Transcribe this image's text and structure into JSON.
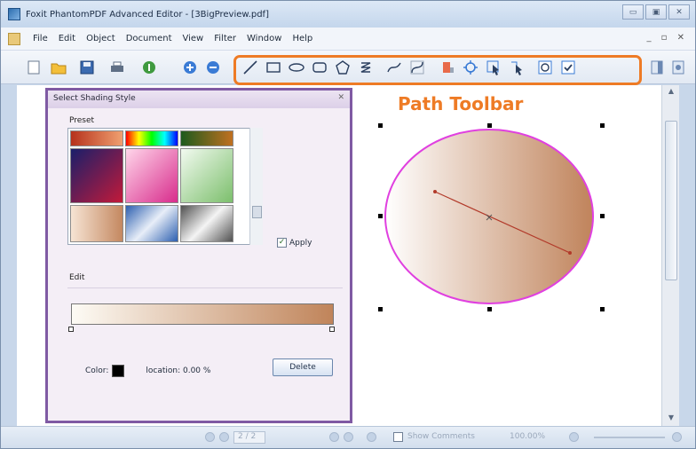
{
  "window": {
    "title": "Foxit PhantomPDF Advanced Editor - [3BigPreview.pdf]",
    "controls": [
      "▭",
      "▣",
      "✕"
    ]
  },
  "menu": {
    "items": [
      "File",
      "Edit",
      "Object",
      "Document",
      "View",
      "Filter",
      "Window",
      "Help"
    ],
    "mdi_controls": "_ ▫ ✕"
  },
  "toolbar": {
    "left_tools": [
      "new-page-icon",
      "open-folder-icon",
      "save-icon",
      "print-icon",
      "info-icon",
      "zoom-in-icon",
      "zoom-out-icon"
    ],
    "path_tools": [
      "line-icon",
      "rectangle-icon",
      "ellipse-icon",
      "rounded-rectangle-icon",
      "polygon-icon",
      "spiral-icon",
      "curve-icon",
      "bezier-icon",
      "paint-icon",
      "move-points-icon",
      "select-icon",
      "select-nodes-icon",
      "object-icon",
      "check-icon"
    ],
    "right_tools": [
      "panel-icon",
      "panel-alt-icon"
    ],
    "highlight_color": "#ee7b25"
  },
  "callout": {
    "label": "Path Toolbar"
  },
  "dialog": {
    "title": "Select Shading Style",
    "close": "✕",
    "preset_label": "Preset",
    "presets": [
      {
        "name": "preset-red-orange",
        "colors": [
          "#b6321c",
          "#f0a070"
        ]
      },
      {
        "name": "preset-rainbow",
        "colors": [
          "#ff0000",
          "#00ff00",
          "#0000ff"
        ]
      },
      {
        "name": "preset-dark-green",
        "colors": [
          "#1d5a1d",
          "#c07020"
        ]
      },
      {
        "name": "preset-navy-red",
        "colors": [
          "#1a1f6a",
          "#c21a3a"
        ]
      },
      {
        "name": "preset-pink",
        "colors": [
          "#ffd6ea",
          "#d82c8c"
        ]
      },
      {
        "name": "preset-light-green",
        "colors": [
          "#f2faf0",
          "#7cbf6c"
        ]
      },
      {
        "name": "preset-peach",
        "colors": [
          "#f6e4d4",
          "#c48860"
        ]
      },
      {
        "name": "preset-blue-silver",
        "colors": [
          "#2d5fb0",
          "#e8eef8"
        ]
      },
      {
        "name": "preset-grey-chrome",
        "colors": [
          "#505050",
          "#f4f4f4"
        ]
      }
    ],
    "apply_label": "Apply",
    "apply_checked": true,
    "edit_label": "Edit",
    "gradient": {
      "start": "#fdfbf5",
      "end": "#c0845a"
    },
    "color_label": "Color:",
    "color_value": "#000000",
    "location_label": "location: 0.00 %",
    "delete_label": "Delete"
  },
  "canvas": {
    "ellipse_fill_start": "#ffffff",
    "ellipse_fill_end": "#c0835b",
    "ellipse_stroke": "#e040e0",
    "gradient_line_color": "#b23a2a"
  },
  "statusbar": {
    "page_field": "2 / 2",
    "show_comments": "Show Comments",
    "zoom": "100.00%"
  }
}
